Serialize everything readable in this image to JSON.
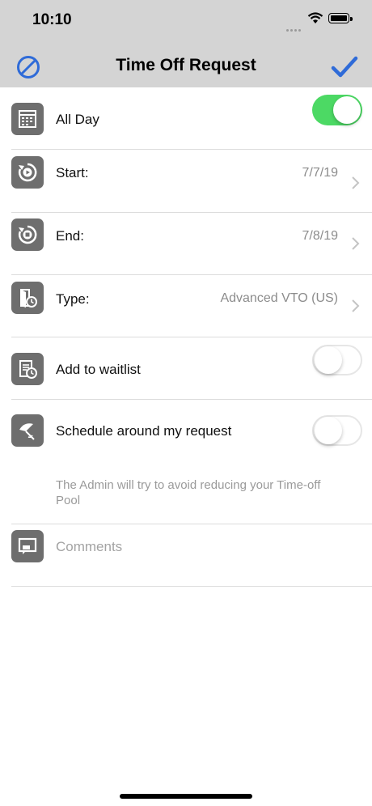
{
  "status_bar": {
    "time": "10:10"
  },
  "nav": {
    "title": "Time Off Request",
    "cancel_icon": "cancel-icon",
    "confirm_icon": "checkmark-icon",
    "accent": "#2f6bd8"
  },
  "rows": {
    "all_day": {
      "label": "All Day",
      "toggle_on": true,
      "icon": "calendar-icon"
    },
    "start": {
      "label": "Start:",
      "value": "7/7/19",
      "icon": "play-clock-icon"
    },
    "end": {
      "label": "End:",
      "value": "7/8/19",
      "icon": "stop-clock-icon"
    },
    "type": {
      "label": "Type:",
      "value": "Advanced VTO (US)",
      "icon": "door-clock-icon"
    },
    "waitlist": {
      "label": "Add to waitlist",
      "toggle_on": false,
      "icon": "list-clock-icon"
    },
    "schedule": {
      "label": "Schedule around my request",
      "toggle_on": false,
      "icon": "umbrella-icon"
    }
  },
  "hint": "The Admin will try to avoid reducing your Time-off Pool",
  "comments": {
    "placeholder": "Comments",
    "icon": "comment-icon"
  },
  "colors": {
    "toggle_on": "#4cd964",
    "bar_background": "#d4d4d4"
  }
}
